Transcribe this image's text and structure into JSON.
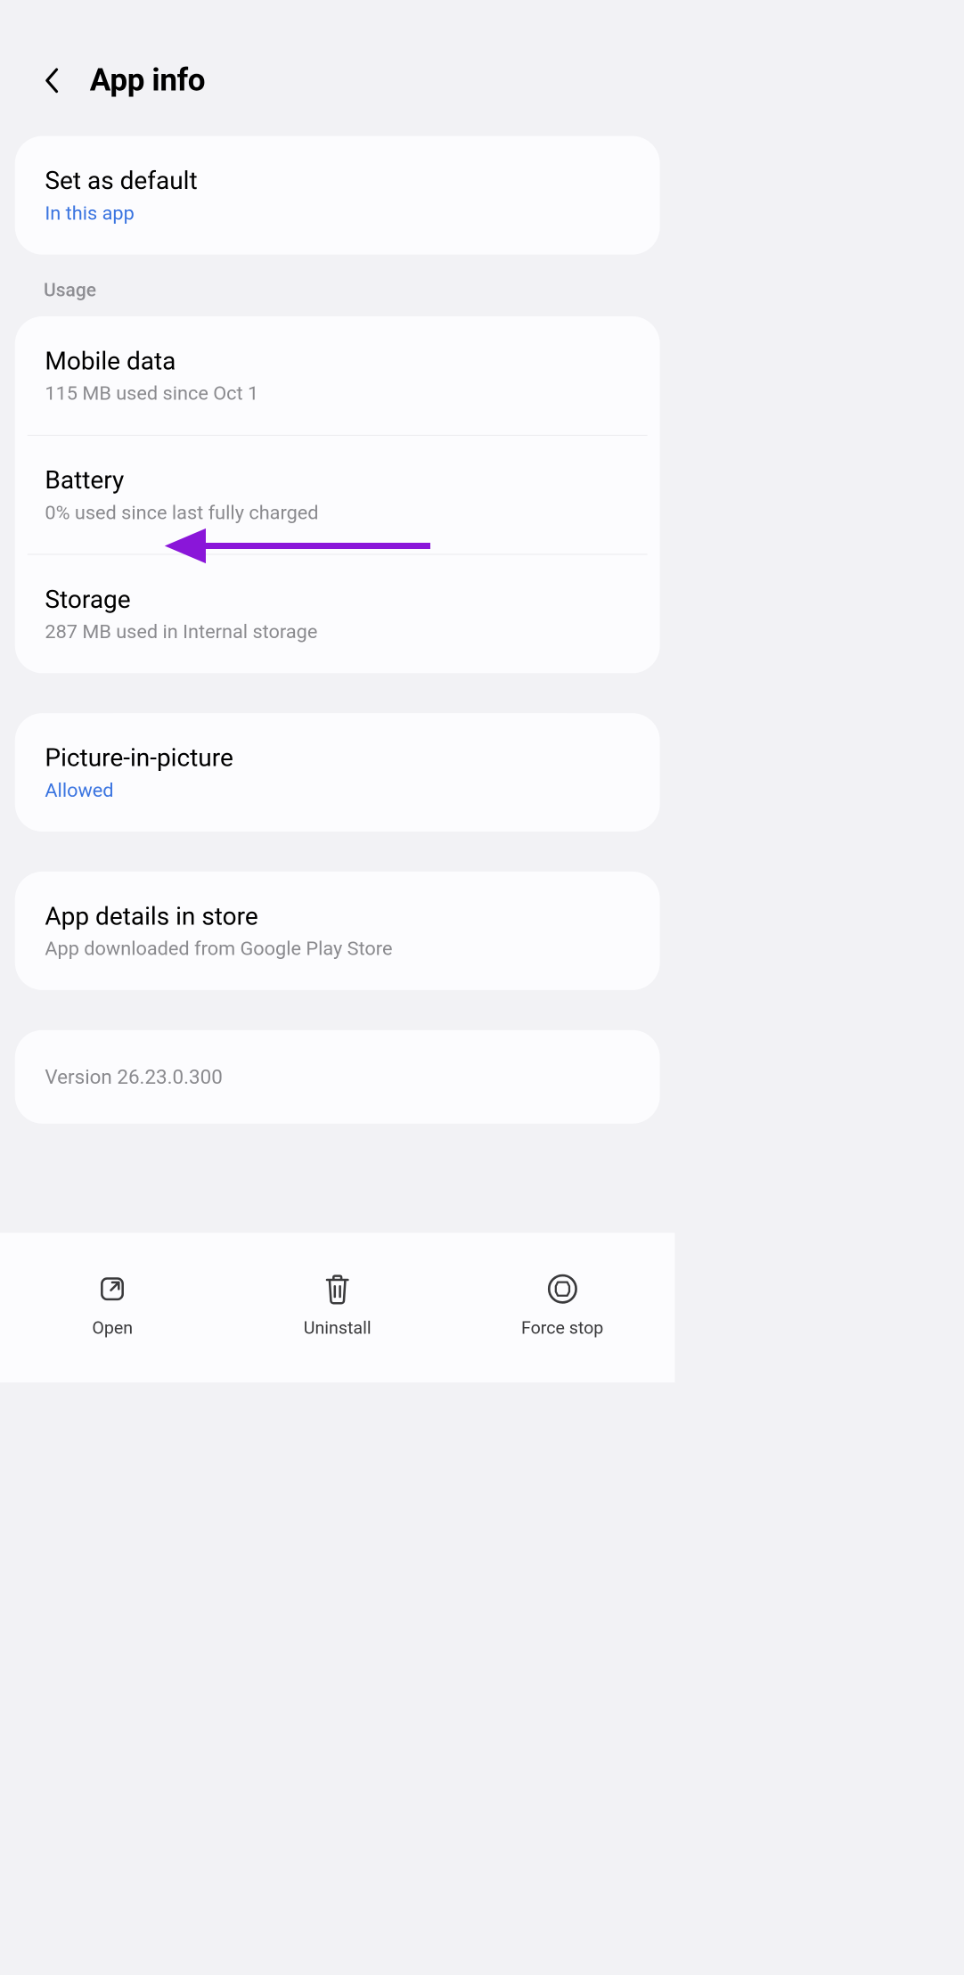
{
  "header": {
    "title": "App info"
  },
  "defaults": {
    "title": "Set as default",
    "subtitle": "In this app"
  },
  "usage_label": "Usage",
  "usage": {
    "mobile_data": {
      "title": "Mobile data",
      "subtitle": "115 MB used since Oct 1"
    },
    "battery": {
      "title": "Battery",
      "subtitle": "0% used since last fully charged"
    },
    "storage": {
      "title": "Storage",
      "subtitle": "287 MB used in Internal storage"
    }
  },
  "pip": {
    "title": "Picture-in-picture",
    "subtitle": "Allowed"
  },
  "store": {
    "title": "App details in store",
    "subtitle": "App downloaded from Google Play Store"
  },
  "version": "Version 26.23.0.300",
  "bottom": {
    "open": "Open",
    "uninstall": "Uninstall",
    "force_stop": "Force stop"
  }
}
